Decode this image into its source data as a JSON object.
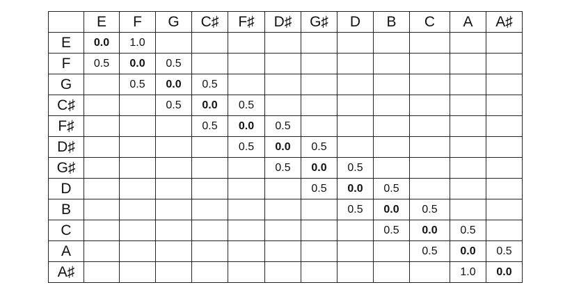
{
  "table": {
    "corner": "",
    "columns": [
      "E",
      "F",
      "G",
      "C♯",
      "F♯",
      "D♯",
      "G♯",
      "D",
      "B",
      "C",
      "A",
      "A♯"
    ],
    "rows": [
      {
        "label": "E",
        "cells": [
          "0.0",
          "1.0",
          "",
          "",
          "",
          "",
          "",
          "",
          "",
          "",
          "",
          ""
        ]
      },
      {
        "label": "F",
        "cells": [
          "0.5",
          "0.0",
          "0.5",
          "",
          "",
          "",
          "",
          "",
          "",
          "",
          "",
          ""
        ]
      },
      {
        "label": "G",
        "cells": [
          "",
          "0.5",
          "0.0",
          "0.5",
          "",
          "",
          "",
          "",
          "",
          "",
          "",
          ""
        ]
      },
      {
        "label": "C♯",
        "cells": [
          "",
          "",
          "0.5",
          "0.0",
          "0.5",
          "",
          "",
          "",
          "",
          "",
          "",
          ""
        ]
      },
      {
        "label": "F♯",
        "cells": [
          "",
          "",
          "",
          "0.5",
          "0.0",
          "0.5",
          "",
          "",
          "",
          "",
          "",
          ""
        ]
      },
      {
        "label": "D♯",
        "cells": [
          "",
          "",
          "",
          "",
          "0.5",
          "0.0",
          "0.5",
          "",
          "",
          "",
          "",
          ""
        ]
      },
      {
        "label": "G♯",
        "cells": [
          "",
          "",
          "",
          "",
          "",
          "0.5",
          "0.0",
          "0.5",
          "",
          "",
          "",
          ""
        ]
      },
      {
        "label": "D",
        "cells": [
          "",
          "",
          "",
          "",
          "",
          "",
          "0.5",
          "0.0",
          "0.5",
          "",
          "",
          ""
        ]
      },
      {
        "label": "B",
        "cells": [
          "",
          "",
          "",
          "",
          "",
          "",
          "",
          "0.5",
          "0.0",
          "0.5",
          "",
          ""
        ]
      },
      {
        "label": "C",
        "cells": [
          "",
          "",
          "",
          "",
          "",
          "",
          "",
          "",
          "0.5",
          "0.0",
          "0.5",
          ""
        ]
      },
      {
        "label": "A",
        "cells": [
          "",
          "",
          "",
          "",
          "",
          "",
          "",
          "",
          "",
          "0.5",
          "0.0",
          "0.5"
        ]
      },
      {
        "label": "A♯",
        "cells": [
          "",
          "",
          "",
          "",
          "",
          "",
          "",
          "",
          "",
          "",
          "1.0",
          "0.0"
        ]
      }
    ]
  }
}
